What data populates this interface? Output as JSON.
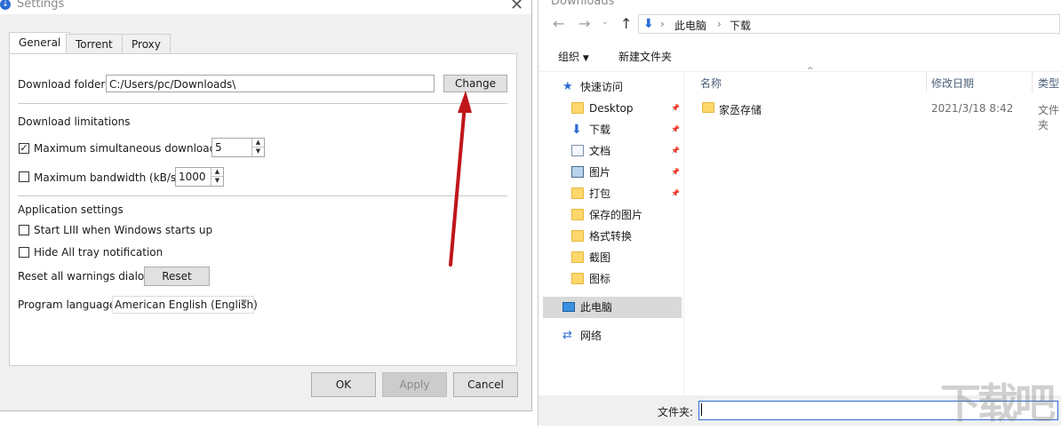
{
  "settings": {
    "title": "Settings",
    "tabs": [
      "General",
      "Torrent",
      "Proxy"
    ],
    "download_folder_label": "Download folder:",
    "download_folder_value": "C:/Users/pc/Downloads\\",
    "change_label": "Change",
    "download_limitations_heading": "Download limitations",
    "max_downloads_label": "Maximum simultaneous downloads",
    "max_downloads_checked": true,
    "max_downloads_value": "5",
    "max_bandwidth_label": "Maximum bandwidth (kB/s)",
    "max_bandwidth_checked": false,
    "max_bandwidth_value": "1000",
    "app_settings_heading": "Application settings",
    "start_label": "Start LIII when Windows starts up",
    "start_checked": false,
    "hide_tray_label": "Hide All tray notification",
    "hide_tray_checked": false,
    "reset_label": "Reset all warnings dialogs",
    "reset_button": "Reset",
    "language_label": "Program language",
    "language_value": "American English (English)",
    "ok": "OK",
    "apply": "Apply",
    "cancel": "Cancel"
  },
  "explorer": {
    "title": "Downloads",
    "breadcrumb": [
      "此电脑",
      "下载"
    ],
    "toolbar": {
      "organize": "组织",
      "new_folder": "新建文件夹"
    },
    "nav": {
      "quick_access": "快速访问",
      "items": [
        "Desktop",
        "下载",
        "文档",
        "图片",
        "打包",
        "保存的图片",
        "格式转换",
        "截图",
        "图标"
      ],
      "this_pc": "此电脑",
      "network": "网络"
    },
    "columns": {
      "name": "名称",
      "date": "修改日期",
      "type": "类型"
    },
    "files": [
      {
        "name": "家丞存储",
        "date": "2021/3/18 8:42",
        "type": "文件夹"
      }
    ],
    "folder_label": "文件夹:",
    "folder_value": ""
  },
  "colors": {
    "arrow": "#c0151b",
    "accent": "#2b6cd4",
    "selection": "#d9d9d9"
  },
  "watermark": "下载吧"
}
